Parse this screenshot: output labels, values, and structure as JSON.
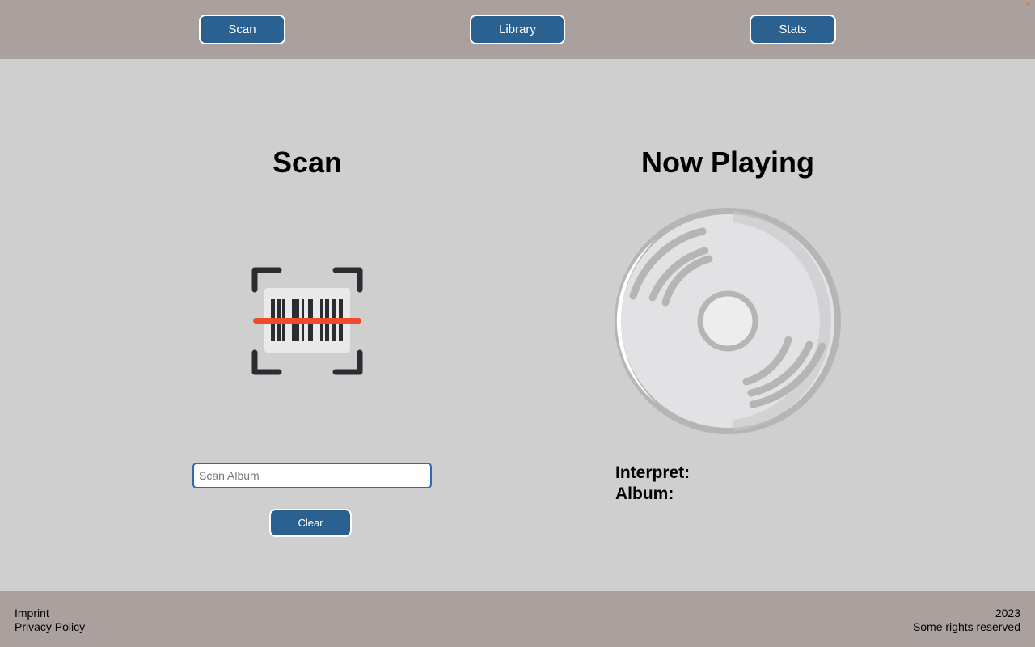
{
  "nav": {
    "scan_label": "Scan",
    "library_label": "Library",
    "stats_label": "Stats"
  },
  "scan_section": {
    "title": "Scan",
    "icon": "barcode-scanner-icon",
    "input_placeholder": "Scan Album",
    "input_value": "",
    "clear_label": "Clear"
  },
  "now_playing": {
    "title": "Now Playing",
    "icon": "disc-icon",
    "interpret_label": "Interpret:",
    "album_label": "Album:"
  },
  "footer": {
    "imprint": "Imprint",
    "privacy": "Privacy Policy",
    "year": "2023",
    "rights": "Some rights reserved"
  },
  "colors": {
    "header_bg": "#aaa09e",
    "page_bg": "#cfcfcf",
    "button": "#2b6190",
    "scan_line": "#ef4a2b"
  }
}
